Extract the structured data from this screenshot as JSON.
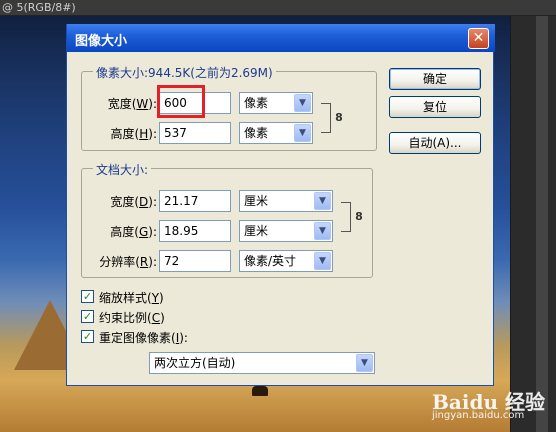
{
  "app": {
    "document_title": "@ 5(RGB/8#)"
  },
  "dialog": {
    "title": "图像大小",
    "close_glyph": "✕",
    "pixel_group": {
      "legend": "像素大小:944.5K(之前为2.69M)",
      "width": {
        "label": "宽度(",
        "hotkey": "W",
        "label_end": "):",
        "value": "600",
        "unit": "像素"
      },
      "height": {
        "label": "高度(",
        "hotkey": "H",
        "label_end": "):",
        "value": "537",
        "unit": "像素"
      }
    },
    "doc_group": {
      "legend": "文档大小:",
      "width": {
        "label": "宽度(",
        "hotkey": "D",
        "label_end": "):",
        "value": "21.17",
        "unit": "厘米"
      },
      "height": {
        "label": "高度(",
        "hotkey": "G",
        "label_end": "):",
        "value": "18.95",
        "unit": "厘米"
      },
      "resolution": {
        "label": "分辨率(",
        "hotkey": "R",
        "label_end": "):",
        "value": "72",
        "unit": "像素/英寸"
      }
    },
    "buttons": {
      "ok": "确定",
      "reset": "复位",
      "auto": "自动(A)..."
    },
    "checkboxes": [
      {
        "label": "缩放样式(",
        "hotkey": "Y",
        "label_end": ")",
        "checked": true
      },
      {
        "label": "约束比例(",
        "hotkey": "C",
        "label_end": ")",
        "checked": true
      },
      {
        "label": "重定图像像素(",
        "hotkey": "I",
        "label_end": "):",
        "checked": true
      }
    ],
    "resample": {
      "value": "两次立方(自动)"
    },
    "check_glyph": "✓",
    "chain_glyph": "8",
    "arrow_glyph": "▼"
  },
  "watermark": {
    "logo": "Baidu 经验",
    "url": "jingyan.baidu.com"
  },
  "colors": {
    "titlebar": "#0a46c2",
    "dialog_bg": "#ece9d8",
    "highlight": "#e2212b",
    "legend_text": "#1d3b8c"
  }
}
